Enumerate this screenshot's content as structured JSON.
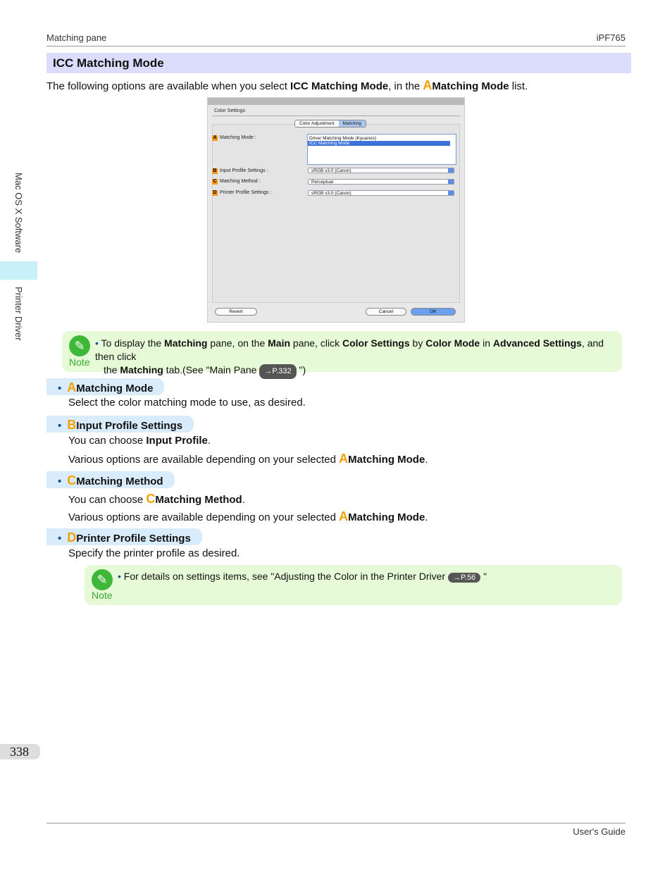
{
  "header": {
    "left": "Matching pane",
    "right": "iPF765"
  },
  "title": "ICC Matching Mode",
  "intro": {
    "pre": "The following options are available when you select ",
    "b1": "ICC Matching Mode",
    "mid": ", in the ",
    "letter": "A",
    "b2": "Matching Mode",
    "post": " list."
  },
  "screenshot": {
    "group": "Color Settings",
    "tabs": [
      "Color Adjustment",
      "Matching"
    ],
    "rows": [
      {
        "letter": "A",
        "label": "Matching Mode :"
      },
      {
        "letter": "B",
        "label": "Input Profile Settings :",
        "value": "sRGB v3.0 (Canon)"
      },
      {
        "letter": "C",
        "label": "Matching Method :",
        "value": "Perceptual"
      },
      {
        "letter": "D",
        "label": "Printer Profile Settings :",
        "value": "sRGB v3.0 (Canon)"
      }
    ],
    "list": [
      "Driver Matching Mode (Kyuanos)",
      "ICC Matching Mode"
    ],
    "buttons": {
      "revert": "Revert",
      "cancel": "Cancel",
      "ok": "OK"
    }
  },
  "note1": {
    "label": "Note",
    "t1": "To display the ",
    "b1": "Matching",
    "t2": " pane, on the ",
    "b2": "Main",
    "t3": " pane, click ",
    "b3": "Color Settings",
    "t4": " by ",
    "b4": "Color Mode",
    "t5": " in ",
    "b5": "Advanced Settings",
    "t6": ", and then click",
    "t7": "the ",
    "b6": "Matching",
    "t8": " tab.(See \"Main Pane ",
    "ref": "→P.332",
    "t9": " \")"
  },
  "sections": [
    {
      "letter": "A",
      "title": "Matching Mode",
      "lines": [
        {
          "text": "Select the color matching mode to use, as desired."
        }
      ]
    },
    {
      "letter": "B",
      "title": "Input Profile Settings",
      "lines": [
        {
          "pre": "You can choose ",
          "bold": "Input Profile",
          "post": "."
        },
        {
          "pre": "Various options are available depending on your selected ",
          "letter": "A",
          "bold": "Matching Mode",
          "post": "."
        }
      ]
    },
    {
      "letter": "C",
      "title": "Matching Method",
      "lines": [
        {
          "pre": "You can choose ",
          "letter": "C",
          "bold": "Matching Method",
          "post": "."
        },
        {
          "pre": "Various options are available depending on your selected ",
          "letter": "A",
          "bold": "Matching Mode",
          "post": "."
        }
      ]
    },
    {
      "letter": "D",
      "title": "Printer Profile Settings",
      "lines": [
        {
          "text": "Specify the printer profile as desired."
        }
      ]
    }
  ],
  "note2": {
    "label": "Note",
    "t1": "For details on settings items, see \"Adjusting the Color in the Printer Driver ",
    "ref": "→P.56",
    "t2": " \""
  },
  "side": {
    "tab1": "Mac OS X Software",
    "tab2": "Printer Driver"
  },
  "page_number": "338",
  "footer": "User's Guide"
}
